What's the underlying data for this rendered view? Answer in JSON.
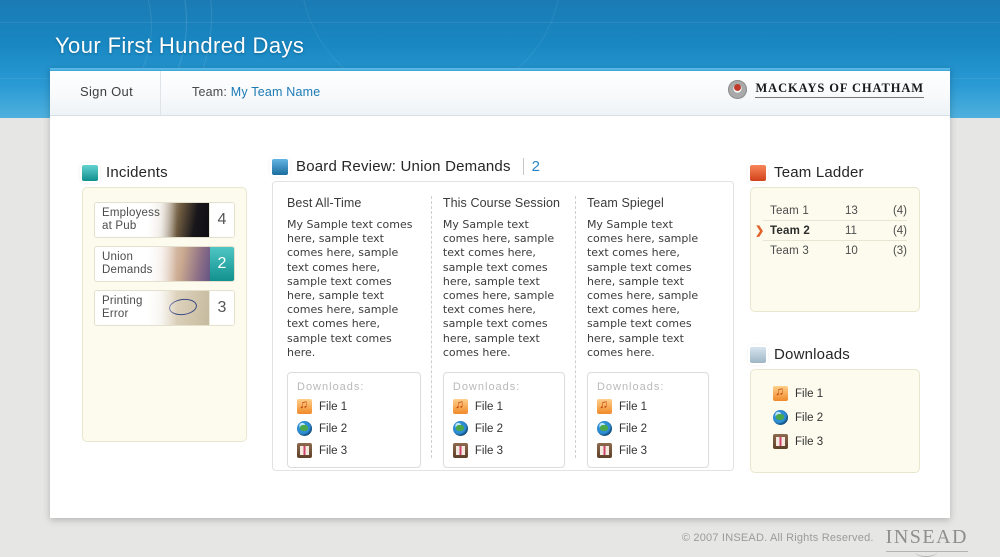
{
  "header": {
    "app_title": "Your First Hundred Days",
    "bg_color": "#1887c2"
  },
  "toolbar": {
    "sign_out": "Sign Out",
    "team_prefix": "Team:",
    "team_name": "My Team Name",
    "logo_text": "MACKAYS OF CHATHAM",
    "logo_icon": "circle-logo-icon"
  },
  "incidents": {
    "title": "Incidents",
    "icon": "teal-square-icon",
    "items": [
      {
        "label_line1": "Employess",
        "label_line2": "at Pub",
        "count": "4",
        "selected": false
      },
      {
        "label_line1": "Union",
        "label_line2": "Demands",
        "count": "2",
        "selected": true
      },
      {
        "label_line1": "Printing",
        "label_line2": "Error",
        "count": "3",
        "selected": false
      }
    ]
  },
  "board_review": {
    "title": "Board Review: Union Demands",
    "badge": "2",
    "icon": "blue-square-icon",
    "columns": [
      {
        "header": "Best All-Time",
        "body": "My Sample text comes here, sample text comes here, sample text comes here, sample text comes here, sample text comes here, sample text comes here, sample text comes here.",
        "downloads_label": "Downloads:",
        "files": [
          {
            "name": "File 1",
            "icon": "music-file-icon"
          },
          {
            "name": "File 2",
            "icon": "globe-file-icon"
          },
          {
            "name": "File 3",
            "icon": "book-file-icon"
          }
        ]
      },
      {
        "header": "This Course Session",
        "body": "My Sample text comes here, sample text comes here, sample text comes here, sample text comes here, sample text comes here, sample text comes here, sample text comes here.",
        "downloads_label": "Downloads:",
        "files": [
          {
            "name": "File 1",
            "icon": "music-file-icon"
          },
          {
            "name": "File 2",
            "icon": "globe-file-icon"
          },
          {
            "name": "File 3",
            "icon": "book-file-icon"
          }
        ]
      },
      {
        "header": "Team Spiegel",
        "body": "My Sample text comes here, sample text comes here, sample text comes here, sample text comes here, sample text comes here, sample text comes here, sample text comes here.",
        "downloads_label": "Downloads:",
        "files": [
          {
            "name": "File 1",
            "icon": "music-file-icon"
          },
          {
            "name": "File 2",
            "icon": "globe-file-icon"
          },
          {
            "name": "File 3",
            "icon": "book-file-icon"
          }
        ]
      }
    ]
  },
  "team_ladder": {
    "title": "Team Ladder",
    "icon": "orange-square-icon",
    "rows": [
      {
        "name": "Team 1",
        "score": "13",
        "extra": "(4)",
        "selected": false,
        "arrow": ""
      },
      {
        "name": "Team 2",
        "score": "11",
        "extra": "(4)",
        "selected": true,
        "arrow": "❯"
      },
      {
        "name": "Team 3",
        "score": "10",
        "extra": "(3)",
        "selected": false,
        "arrow": ""
      }
    ]
  },
  "downloads_panel": {
    "title": "Downloads",
    "icon": "gray-square-icon",
    "files": [
      {
        "name": "File 1",
        "icon": "music-file-icon"
      },
      {
        "name": "File 2",
        "icon": "globe-file-icon"
      },
      {
        "name": "File 3",
        "icon": "book-file-icon"
      }
    ]
  },
  "footer": {
    "copyright": "© 2007 INSEAD. All Rights Reserved.",
    "logo": "INSEAD"
  }
}
